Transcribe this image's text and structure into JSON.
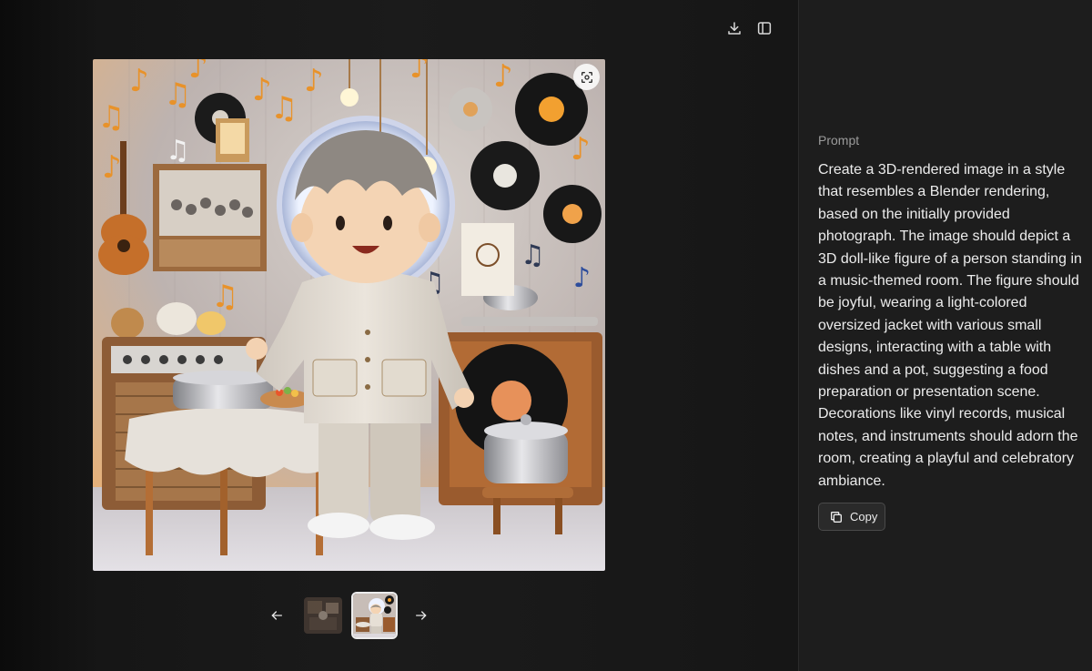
{
  "toolbar": {
    "download_icon": "download-icon",
    "sidebar_toggle_icon": "sidebar-toggle-icon"
  },
  "viewer": {
    "select_icon": "select-area-icon",
    "prev_icon": "arrow-left-icon",
    "next_icon": "arrow-right-icon",
    "thumbnails": [
      {
        "selected": false
      },
      {
        "selected": true
      }
    ]
  },
  "side": {
    "prompt_label": "Prompt",
    "prompt_text": "Create a 3D-rendered image in a style that resembles a Blender rendering, based on the initially provided photograph. The image should depict a 3D doll-like figure of a person standing in a music-themed room. The figure should be joyful, wearing a light-colored oversized jacket with various small designs, interacting with a table with dishes and a pot, suggesting a food preparation or presentation scene. Decorations like vinyl records, musical notes, and instruments should adorn the room, creating a playful and celebratory ambiance.",
    "copy_label": "Copy",
    "copy_icon": "copy-icon"
  },
  "colors": {
    "sidebar_bg": "#1d1d1d",
    "viewer_bg": "#171717",
    "text_primary": "#ececec",
    "text_muted": "#9b9b9b"
  }
}
